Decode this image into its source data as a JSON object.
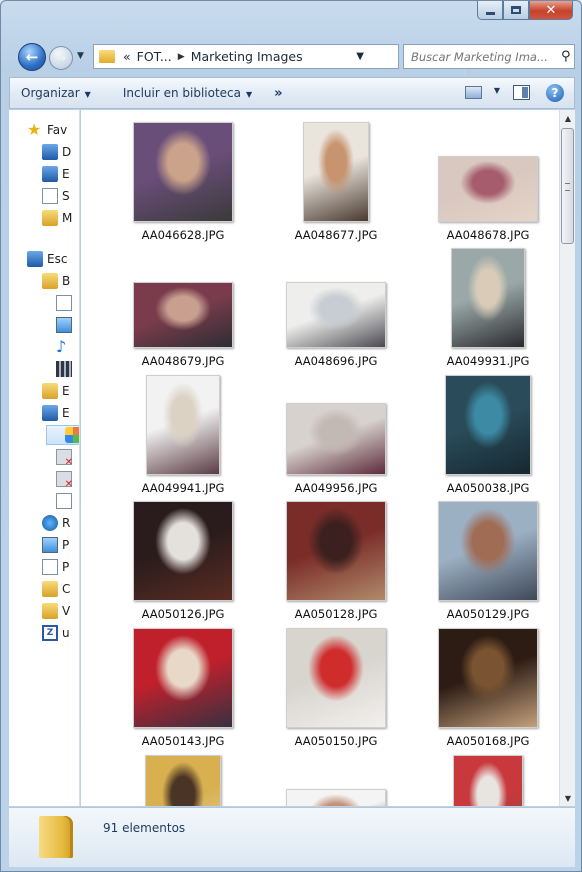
{
  "window": {
    "minimize_symbol": "",
    "maximize_symbol": "",
    "close_symbol": "✕"
  },
  "address": {
    "prefix": "«",
    "segments": [
      "FOT...",
      "Marketing Images"
    ]
  },
  "search": {
    "placeholder": "Buscar Marketing Ima..."
  },
  "toolbar": {
    "organize": "Organizar",
    "include": "Incluir en biblioteca",
    "more": "»",
    "help": "?"
  },
  "sidebar": {
    "items": [
      {
        "label": "Fav",
        "icon": "star-icon"
      },
      {
        "label": "D",
        "icon": "desktop-folder-icon"
      },
      {
        "label": "E",
        "icon": "computer-icon"
      },
      {
        "label": "S",
        "icon": "drive-icon"
      },
      {
        "label": "M",
        "icon": "folder-icon"
      },
      {
        "label": "Esc",
        "icon": "desktop-icon"
      },
      {
        "label": "B",
        "icon": "library-folder-icon"
      },
      {
        "label": "",
        "icon": "document-icon"
      },
      {
        "label": "",
        "icon": "pictures-icon"
      },
      {
        "label": "",
        "icon": "music-note-icon"
      },
      {
        "label": "",
        "icon": "video-film-icon"
      },
      {
        "label": "E",
        "icon": "user-folder-icon"
      },
      {
        "label": "E",
        "icon": "computer-icon"
      },
      {
        "label": "",
        "icon": "windows-drive-icon"
      },
      {
        "label": "",
        "icon": "disconnected-drive-icon"
      },
      {
        "label": "",
        "icon": "disconnected-drive-icon"
      },
      {
        "label": "",
        "icon": "removable-drive-icon"
      },
      {
        "label": "R",
        "icon": "network-icon"
      },
      {
        "label": "P",
        "icon": "control-panel-icon"
      },
      {
        "label": "P",
        "icon": "recycle-icon"
      },
      {
        "label": "C",
        "icon": "folder-icon"
      },
      {
        "label": "V",
        "icon": "folder-icon"
      },
      {
        "label": "u",
        "icon": "zip-icon"
      }
    ]
  },
  "files": [
    {
      "name": "AA046628.JPG",
      "colors": [
        "#6a4e7a",
        "#caa38a",
        "#3a3a3a"
      ]
    },
    {
      "name": "AA048677.JPG",
      "colors": [
        "#e9e4dc",
        "#c8936f",
        "#4a3a30"
      ]
    },
    {
      "name": "AA048678.JPG",
      "colors": [
        "#d9c8c0",
        "#a65c6c",
        "#e6d3c8"
      ]
    },
    {
      "name": "AA048679.JPG",
      "colors": [
        "#7a3c4c",
        "#c9a090",
        "#2d2d33"
      ]
    },
    {
      "name": "AA048696.JPG",
      "colors": [
        "#eeeeec",
        "#c7cdd2",
        "#4c4a50"
      ]
    },
    {
      "name": "AA049931.JPG",
      "colors": [
        "#9aa9a8",
        "#d9cbb8",
        "#2b2a2e"
      ]
    },
    {
      "name": "AA049941.JPG",
      "colors": [
        "#f2f2f2",
        "#dcd2c4",
        "#5a3c44"
      ]
    },
    {
      "name": "AA049956.JPG",
      "colors": [
        "#d8d2ce",
        "#c2b8b4",
        "#5c2b3c"
      ]
    },
    {
      "name": "AA050038.JPG",
      "colors": [
        "#2a4c5a",
        "#3c8aa4",
        "#162830"
      ]
    },
    {
      "name": "AA050126.JPG",
      "colors": [
        "#2a1c1c",
        "#e4e0dc",
        "#5a2c24"
      ]
    },
    {
      "name": "AA050128.JPG",
      "colors": [
        "#7a2c28",
        "#3c2020",
        "#b08a6a"
      ]
    },
    {
      "name": "AA050129.JPG",
      "colors": [
        "#9cb0c4",
        "#a06c54",
        "#404858"
      ]
    },
    {
      "name": "AA050143.JPG",
      "colors": [
        "#c0202c",
        "#e8d8c8",
        "#383040"
      ]
    },
    {
      "name": "AA050150.JPG",
      "colors": [
        "#d8d4ce",
        "#d02c2c",
        "#f2f0ee"
      ]
    },
    {
      "name": "AA050168.JPG",
      "colors": [
        "#2c1c14",
        "#7a5432",
        "#c4a07c"
      ]
    },
    {
      "name": "",
      "colors": [
        "#d8b050",
        "#4a3426",
        "#e6d4b0"
      ]
    },
    {
      "name": "",
      "colors": [
        "#f4f4f4",
        "#c49078",
        "#3a2c2c"
      ]
    },
    {
      "name": "",
      "colors": [
        "#c8383c",
        "#e8e4e0",
        "#8a5040"
      ]
    }
  ],
  "status": {
    "count": "91 elementos"
  }
}
